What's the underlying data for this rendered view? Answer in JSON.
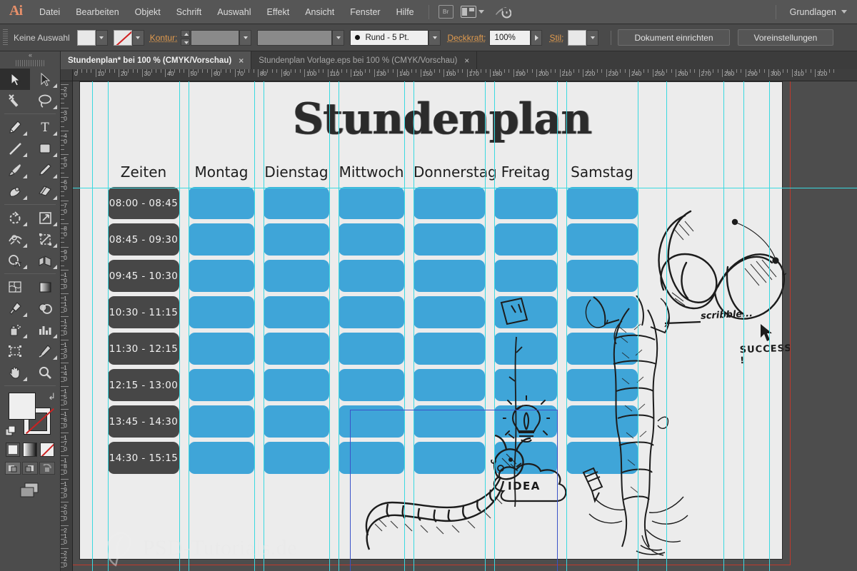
{
  "app": {
    "name": "Ai",
    "logo_text": "Ai"
  },
  "menu": {
    "items": [
      {
        "label": "Datei"
      },
      {
        "label": "Bearbeiten"
      },
      {
        "label": "Objekt"
      },
      {
        "label": "Schrift"
      },
      {
        "label": "Auswahl"
      },
      {
        "label": "Effekt"
      },
      {
        "label": "Ansicht"
      },
      {
        "label": "Fenster"
      },
      {
        "label": "Hilfe"
      }
    ],
    "bridge_label": "Br",
    "arrange_icon": "arrange-documents-icon",
    "workspace_label": "Grundlagen"
  },
  "control_bar": {
    "selection_status": "Keine Auswahl",
    "fill_swatch": "white",
    "stroke_swatch": "none",
    "stroke_label": "Kontur:",
    "stroke_weight": "",
    "stroke_profile": "",
    "brush_definition": "Rund - 5 Pt.",
    "opacity_label": "Deckkraft:",
    "opacity_value": "100%",
    "style_label": "Stil:",
    "document_setup_button": "Dokument einrichten",
    "preferences_button": "Voreinstellungen"
  },
  "tabs": [
    {
      "title": "Stundenplan* bei 100 % (CMYK/Vorschau)",
      "active": true,
      "close": "×"
    },
    {
      "title": "Stundenplan Vorlage.eps bei 100 % (CMYK/Vorschau)",
      "active": false,
      "close": "×"
    }
  ],
  "toolbar": {
    "tools": [
      {
        "name": "selection-tool",
        "selected": true
      },
      {
        "name": "direct-selection-tool",
        "selected": false
      },
      {
        "name": "magic-wand-tool",
        "selected": false
      },
      {
        "name": "lasso-tool",
        "selected": false
      },
      {
        "name": "pen-tool",
        "selected": false
      },
      {
        "name": "type-tool",
        "selected": false
      },
      {
        "name": "line-segment-tool",
        "selected": false
      },
      {
        "name": "rectangle-tool",
        "selected": false
      },
      {
        "name": "paintbrush-tool",
        "selected": false
      },
      {
        "name": "pencil-tool",
        "selected": false
      },
      {
        "name": "blob-brush-tool",
        "selected": false
      },
      {
        "name": "eraser-tool",
        "selected": false
      },
      {
        "name": "rotate-tool",
        "selected": false
      },
      {
        "name": "scale-tool",
        "selected": false
      },
      {
        "name": "width-warp-tool",
        "selected": false
      },
      {
        "name": "free-transform-tool",
        "selected": false
      },
      {
        "name": "shape-builder-tool",
        "selected": false
      },
      {
        "name": "perspective-grid-tool",
        "selected": false
      },
      {
        "name": "mesh-tool",
        "selected": false
      },
      {
        "name": "gradient-tool",
        "selected": false
      },
      {
        "name": "eyedropper-tool",
        "selected": false
      },
      {
        "name": "blend-tool",
        "selected": false
      },
      {
        "name": "symbol-sprayer-tool",
        "selected": false
      },
      {
        "name": "column-graph-tool",
        "selected": false
      },
      {
        "name": "artboard-tool",
        "selected": false
      },
      {
        "name": "slice-tool",
        "selected": false
      },
      {
        "name": "hand-tool",
        "selected": false
      },
      {
        "name": "zoom-tool",
        "selected": false
      }
    ],
    "color_modes": [
      "color-mode",
      "gradient-mode",
      "none-mode"
    ],
    "draw_modes": [
      "draw-normal",
      "draw-behind",
      "draw-inside"
    ],
    "screen_mode": "screen-mode-icon"
  },
  "rulers": {
    "unit_step": 10,
    "h_labels": [
      0,
      10,
      20,
      30,
      40,
      50,
      60,
      70,
      80,
      90,
      100,
      110,
      120,
      130,
      140,
      150,
      160,
      170,
      180,
      190,
      200,
      210,
      220,
      230,
      240,
      250,
      260,
      270,
      280,
      290,
      300,
      310,
      320
    ],
    "v_labels": [
      20,
      30,
      40,
      50,
      60,
      70,
      80,
      90,
      100,
      110,
      120,
      130,
      140,
      150,
      160,
      170,
      180,
      190,
      200,
      210,
      220
    ]
  },
  "document": {
    "title": "Stundenplan",
    "column_headers": [
      "Zeiten",
      "Montag",
      "Dienstag",
      "Mittwoch",
      "Donnerstag",
      "Freitag",
      "Samstag"
    ],
    "time_slots": [
      "08:00 - 08:45",
      "08:45 - 09:30",
      "09:45 - 10:30",
      "10:30 - 11:15",
      "11:30 - 12:15",
      "12:15 - 13:00",
      "13:45 - 14:30",
      "14:30 - 15:15"
    ],
    "cell_color": "#3fa5d8",
    "time_cell_color": "#474747",
    "background_color": "#ececec",
    "guide_color": "#3ad9e0",
    "sketch_labels": [
      {
        "text": "SUCCESS !",
        "name": "success-sketch-label"
      },
      {
        "text": "scribble...",
        "name": "scribble-sketch-label"
      },
      {
        "text": "IDEA",
        "name": "idea-sketch-label"
      }
    ]
  },
  "watermark": {
    "text": "PSD-Tutorials.de"
  }
}
